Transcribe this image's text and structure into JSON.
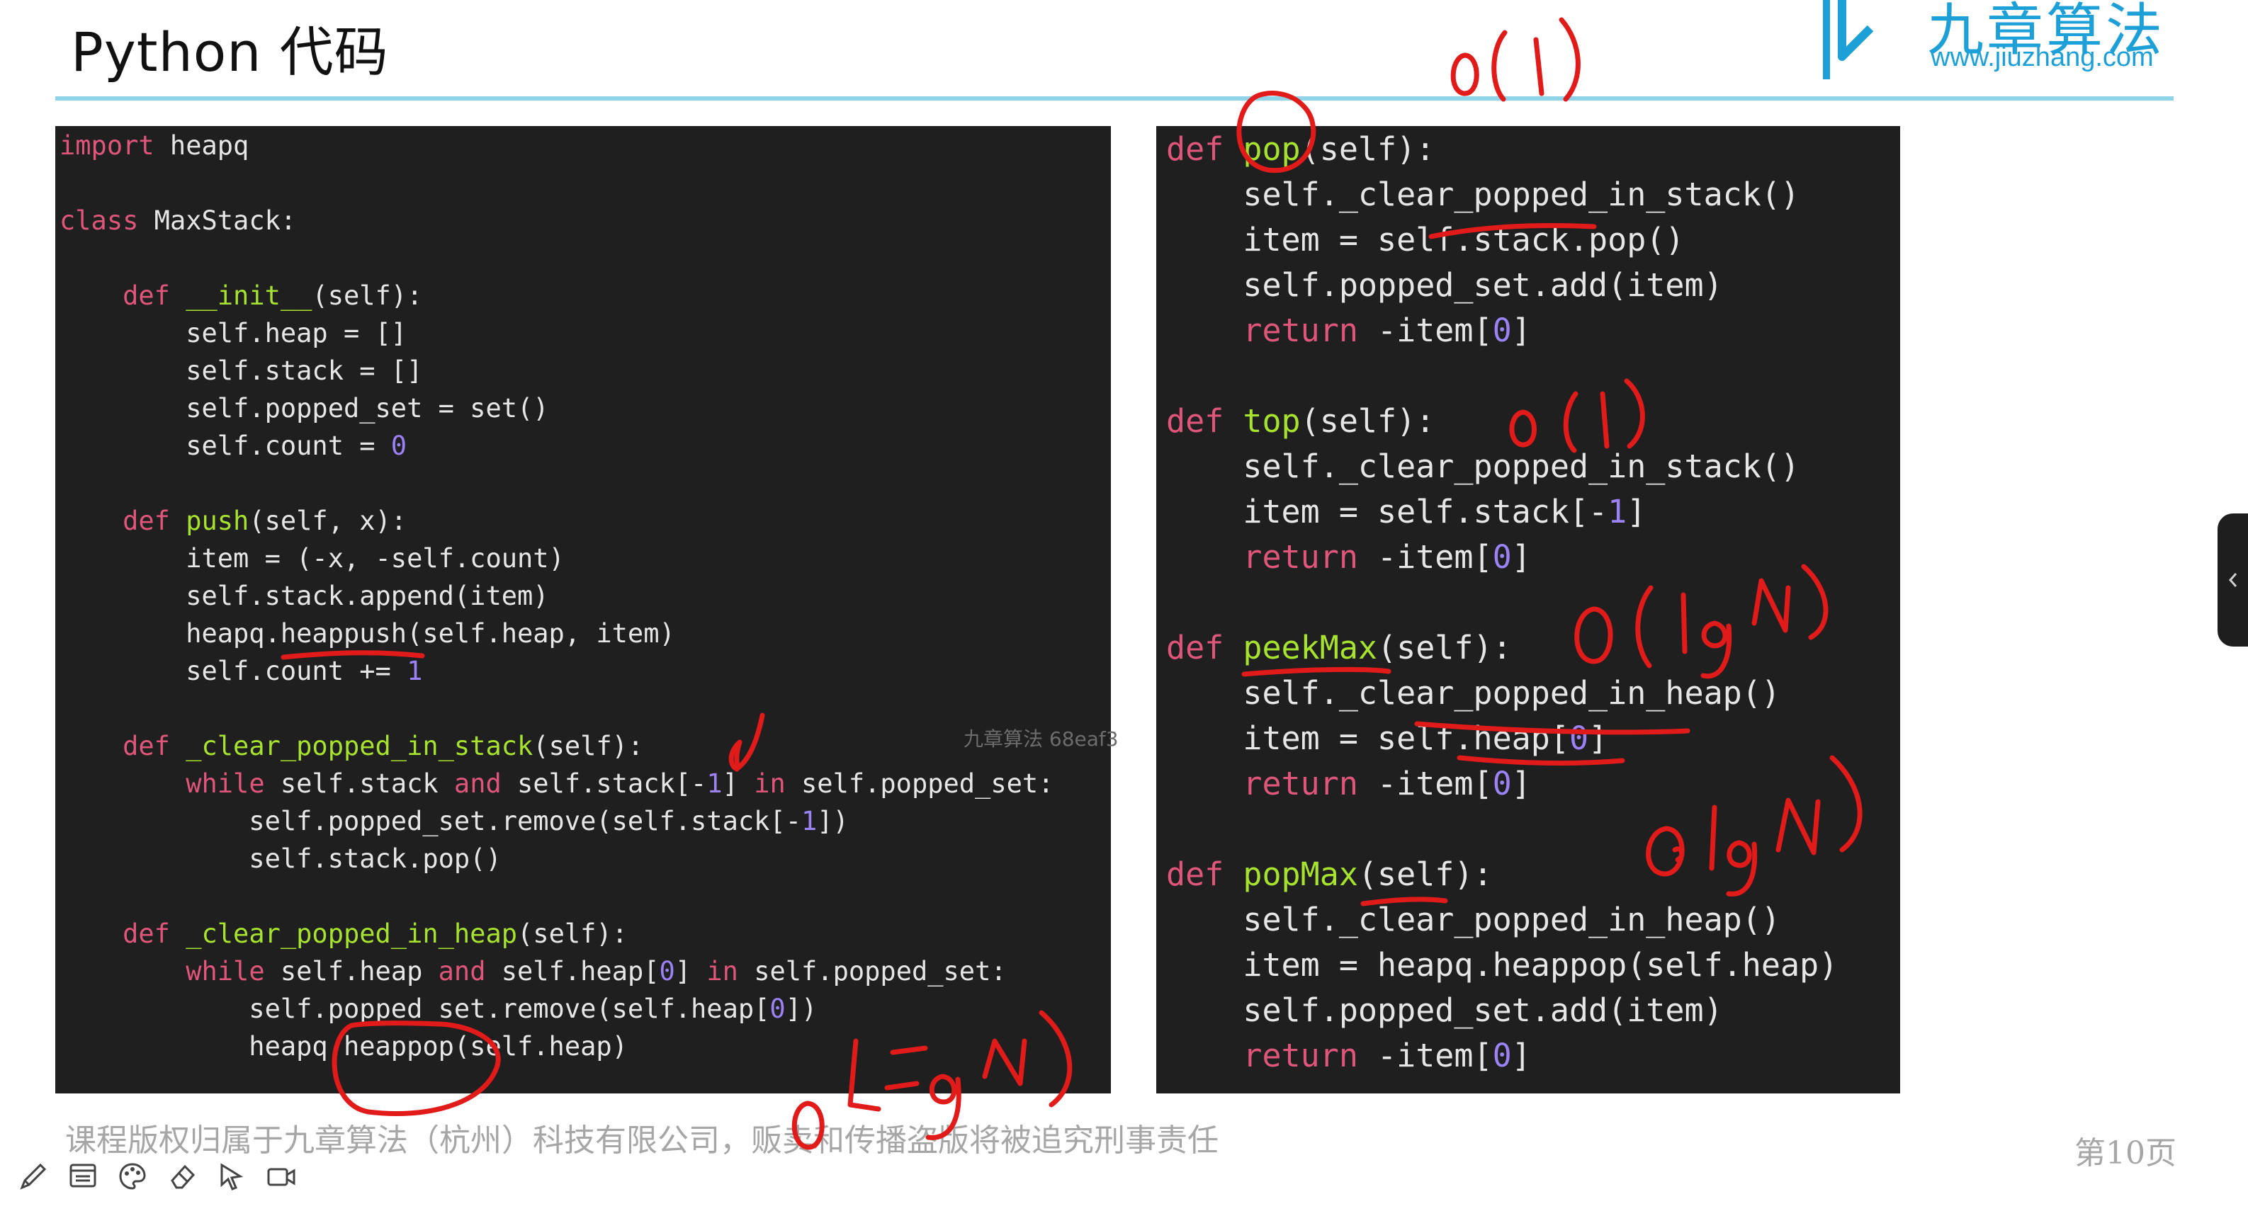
{
  "slide": {
    "title": "Python 代码",
    "logo": {
      "name": "九章算法",
      "url": "www.jiuzhang.com"
    },
    "footer": "课程版权归属于九章算法（杭州）科技有限公司，贩卖和传播盗版将被追究刑事责任",
    "page_number": "第10页",
    "watermark": "九章算法 68eaf3"
  },
  "left_code": [
    [
      [
        "kw",
        "import"
      ],
      [
        "plain",
        " heapq"
      ]
    ],
    [],
    [
      [
        "kw",
        "class"
      ],
      [
        "plain",
        " MaxStack:"
      ]
    ],
    [],
    [
      [
        "plain",
        "    "
      ],
      [
        "kw",
        "def"
      ],
      [
        "plain",
        " "
      ],
      [
        "fn",
        "__init__"
      ],
      [
        "plain",
        "(self):"
      ]
    ],
    [
      [
        "plain",
        "        self.heap = []"
      ]
    ],
    [
      [
        "plain",
        "        self.stack = []"
      ]
    ],
    [
      [
        "plain",
        "        self.popped_set = set()"
      ]
    ],
    [
      [
        "plain",
        "        self.count = "
      ],
      [
        "num",
        "0"
      ]
    ],
    [],
    [
      [
        "plain",
        "    "
      ],
      [
        "kw",
        "def"
      ],
      [
        "plain",
        " "
      ],
      [
        "fn",
        "push"
      ],
      [
        "plain",
        "(self, x):"
      ]
    ],
    [
      [
        "plain",
        "        item = (-x, -self.count)"
      ]
    ],
    [
      [
        "plain",
        "        self.stack.append(item)"
      ]
    ],
    [
      [
        "plain",
        "        heapq.heappush(self.heap, item)"
      ]
    ],
    [
      [
        "plain",
        "        self.count += "
      ],
      [
        "num",
        "1"
      ]
    ],
    [],
    [
      [
        "plain",
        "    "
      ],
      [
        "kw",
        "def"
      ],
      [
        "plain",
        " "
      ],
      [
        "fn",
        "_clear_popped_in_stack"
      ],
      [
        "plain",
        "(self):"
      ]
    ],
    [
      [
        "plain",
        "        "
      ],
      [
        "kw",
        "while"
      ],
      [
        "plain",
        " self.stack "
      ],
      [
        "kw",
        "and"
      ],
      [
        "plain",
        " self.stack[-"
      ],
      [
        "num",
        "1"
      ],
      [
        "plain",
        "] "
      ],
      [
        "kw",
        "in"
      ],
      [
        "plain",
        " self.popped_set:"
      ]
    ],
    [
      [
        "plain",
        "            self.popped_set.remove(self.stack[-"
      ],
      [
        "num",
        "1"
      ],
      [
        "plain",
        "])"
      ]
    ],
    [
      [
        "plain",
        "            self.stack.pop()"
      ]
    ],
    [],
    [
      [
        "plain",
        "    "
      ],
      [
        "kw",
        "def"
      ],
      [
        "plain",
        " "
      ],
      [
        "fn",
        "_clear_popped_in_heap"
      ],
      [
        "plain",
        "(self):"
      ]
    ],
    [
      [
        "plain",
        "        "
      ],
      [
        "kw",
        "while"
      ],
      [
        "plain",
        " self.heap "
      ],
      [
        "kw",
        "and"
      ],
      [
        "plain",
        " self.heap["
      ],
      [
        "num",
        "0"
      ],
      [
        "plain",
        "] "
      ],
      [
        "kw",
        "in"
      ],
      [
        "plain",
        " self.popped_set:"
      ]
    ],
    [
      [
        "plain",
        "            self.popped_set.remove(self.heap["
      ],
      [
        "num",
        "0"
      ],
      [
        "plain",
        "])"
      ]
    ],
    [
      [
        "plain",
        "            heapq.heappop(self.heap)"
      ]
    ]
  ],
  "right_code": [
    [
      [
        "kw",
        "def"
      ],
      [
        "plain",
        " "
      ],
      [
        "fn",
        "pop"
      ],
      [
        "plain",
        "(self):"
      ]
    ],
    [
      [
        "plain",
        "    self._clear_popped_in_stack()"
      ]
    ],
    [
      [
        "plain",
        "    item = self.stack.pop()"
      ]
    ],
    [
      [
        "plain",
        "    self.popped_set.add(item)"
      ]
    ],
    [
      [
        "plain",
        "    "
      ],
      [
        "kw",
        "return"
      ],
      [
        "plain",
        " -item["
      ],
      [
        "num",
        "0"
      ],
      [
        "plain",
        "]"
      ]
    ],
    [],
    [
      [
        "kw",
        "def"
      ],
      [
        "plain",
        " "
      ],
      [
        "fn",
        "top"
      ],
      [
        "plain",
        "(self):"
      ]
    ],
    [
      [
        "plain",
        "    self._clear_popped_in_stack()"
      ]
    ],
    [
      [
        "plain",
        "    item = self.stack[-"
      ],
      [
        "num",
        "1"
      ],
      [
        "plain",
        "]"
      ]
    ],
    [
      [
        "plain",
        "    "
      ],
      [
        "kw",
        "return"
      ],
      [
        "plain",
        " -item["
      ],
      [
        "num",
        "0"
      ],
      [
        "plain",
        "]"
      ]
    ],
    [],
    [
      [
        "kw",
        "def"
      ],
      [
        "plain",
        " "
      ],
      [
        "fn",
        "peekMax"
      ],
      [
        "plain",
        "(self):"
      ]
    ],
    [
      [
        "plain",
        "    self._clear_popped_in_heap()"
      ]
    ],
    [
      [
        "plain",
        "    item = self.heap["
      ],
      [
        "num",
        "0"
      ],
      [
        "plain",
        "]"
      ]
    ],
    [
      [
        "plain",
        "    "
      ],
      [
        "kw",
        "return"
      ],
      [
        "plain",
        " -item["
      ],
      [
        "num",
        "0"
      ],
      [
        "plain",
        "]"
      ]
    ],
    [],
    [
      [
        "kw",
        "def"
      ],
      [
        "plain",
        " "
      ],
      [
        "fn",
        "popMax"
      ],
      [
        "plain",
        "(self):"
      ]
    ],
    [
      [
        "plain",
        "    self._clear_popped_in_heap()"
      ]
    ],
    [
      [
        "plain",
        "    item = heapq.heappop(self.heap)"
      ]
    ],
    [
      [
        "plain",
        "    self.popped_set.add(item)"
      ]
    ],
    [
      [
        "plain",
        "    "
      ],
      [
        "kw",
        "return"
      ],
      [
        "plain",
        " -item["
      ],
      [
        "num",
        "0"
      ],
      [
        "plain",
        "]"
      ]
    ]
  ],
  "toolbar": {
    "tools": [
      "pencil-icon",
      "whiteboard-icon",
      "palette-icon",
      "eraser-icon",
      "pointer-icon",
      "camera-icon"
    ]
  },
  "colors": {
    "code_bg": "#1f1f1f",
    "keyword": "#e0567b",
    "function": "#a6e22e",
    "number": "#9b82f5",
    "accent": "#1d9fd8",
    "ink": "#e11a1a"
  }
}
